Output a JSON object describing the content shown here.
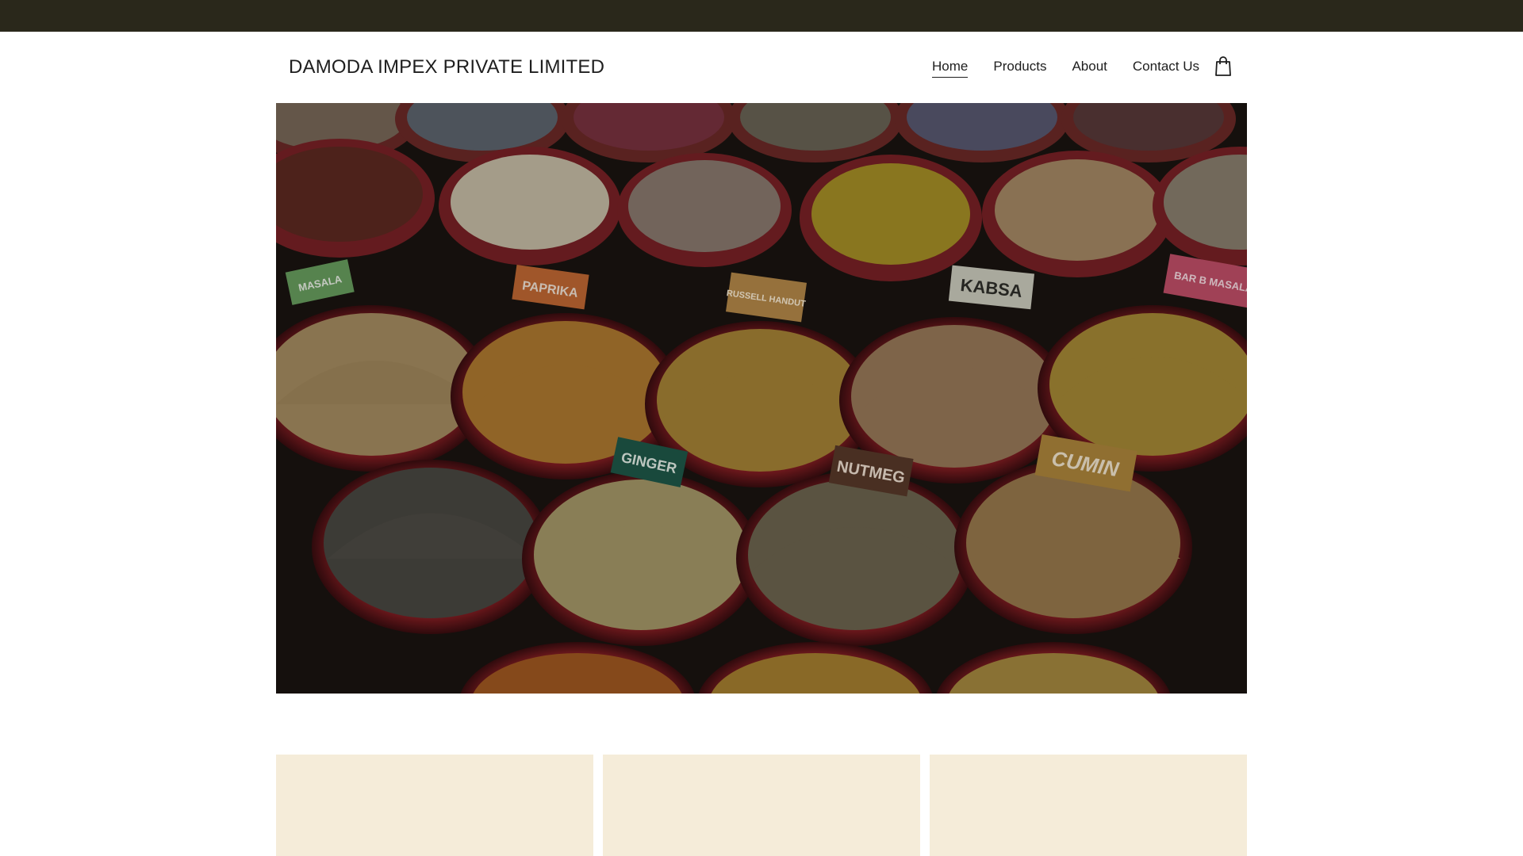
{
  "header": {
    "brand": "DAMODA IMPEX PRIVATE LIMITED",
    "nav": [
      {
        "label": "Home",
        "active": true
      },
      {
        "label": "Products",
        "active": false
      },
      {
        "label": "About",
        "active": false
      },
      {
        "label": "Contact Us",
        "active": false
      }
    ],
    "cart_icon": "shopping-bag-icon"
  },
  "hero": {
    "image": "spice-market-bowls",
    "labels": [
      "MASALA",
      "PAPRIKA",
      "RUSSELL HANDUT",
      "KABSA",
      "BAR B MASALA",
      "GINGER",
      "NUTMEG",
      "CUMIN"
    ]
  },
  "colors": {
    "topbar": "#2a281b",
    "card_bg": "#f5ecd9",
    "text": "#1e1e1e"
  },
  "cards": [
    {},
    {},
    {}
  ]
}
